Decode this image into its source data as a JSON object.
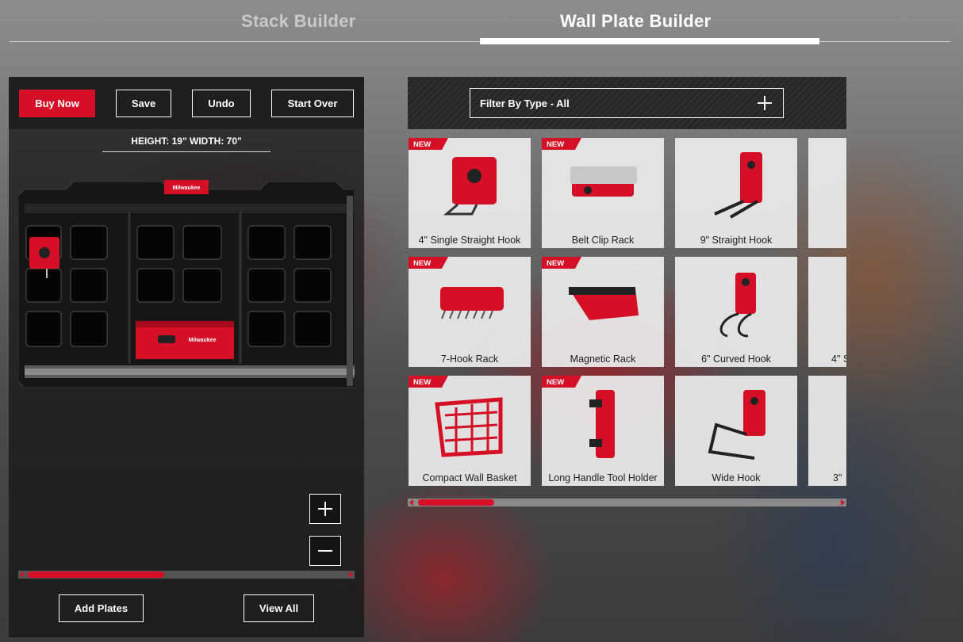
{
  "nav": {
    "tabs": [
      {
        "label": "Stack Builder"
      },
      {
        "label": "Wall Plate Builder"
      }
    ]
  },
  "left_panel": {
    "buttons": {
      "buy_now": "Buy Now",
      "save": "Save",
      "undo": "Undo",
      "start_over": "Start Over"
    },
    "dimensions": "HEIGHT: 19\"  WIDTH: 70\"",
    "bottom_buttons": {
      "add_plates": "Add Plates",
      "view_all": "View All"
    }
  },
  "right_panel": {
    "filter_label": "Filter By Type - All",
    "new_badge": "NEW",
    "products": [
      {
        "name": "4\" Single Straight Hook",
        "new": true,
        "icon": "single-straight-hook-icon"
      },
      {
        "name": "Belt Clip Rack",
        "new": true,
        "icon": "belt-clip-rack-icon"
      },
      {
        "name": "9\" Straight Hook",
        "new": false,
        "icon": "straight-hook-icon"
      },
      {
        "name": "7-Hook Rack",
        "new": true,
        "icon": "seven-hook-rack-icon"
      },
      {
        "name": "Magnetic Rack",
        "new": true,
        "icon": "magnetic-rack-icon"
      },
      {
        "name": "6\" Curved Hook",
        "new": false,
        "icon": "curved-hook-icon"
      },
      {
        "name": "4\" S",
        "new": false,
        "icon": "hook-icon"
      },
      {
        "name": "Compact Wall Basket",
        "new": true,
        "icon": "wall-basket-icon"
      },
      {
        "name": "Long Handle Tool Holder",
        "new": true,
        "icon": "long-handle-holder-icon"
      },
      {
        "name": "Wide Hook",
        "new": false,
        "icon": "wide-hook-icon"
      },
      {
        "name": "3\"",
        "new": false,
        "icon": "hook-icon"
      }
    ],
    "scroll_position": 0.2
  },
  "left_scroll_position": 0.43,
  "colors": {
    "accent": "#d50f25"
  }
}
